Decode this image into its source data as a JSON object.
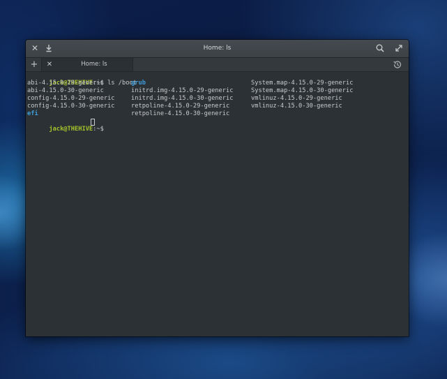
{
  "window": {
    "title": "Home: ls",
    "close_icon": "close-icon",
    "download_icon": "download-icon",
    "search_icon": "search-icon",
    "maximize_icon": "maximize-icon"
  },
  "tabs": {
    "add_icon": "plus-icon",
    "items": [
      {
        "label": "Home: ls",
        "close_icon": "close-icon"
      }
    ],
    "history_icon": "history-icon"
  },
  "terminal": {
    "prompt_user": "jack@THEHIVE",
    "prompt_path": ":~$ ",
    "command": "ls /boot",
    "listing": {
      "col1": [
        {
          "text": "abi-4.15.0-29-generic",
          "type": "file"
        },
        {
          "text": "abi-4.15.0-30-generic",
          "type": "file"
        },
        {
          "text": "config-4.15.0-29-generic",
          "type": "file"
        },
        {
          "text": "config-4.15.0-30-generic",
          "type": "file"
        },
        {
          "text": "efi",
          "type": "dir"
        }
      ],
      "col2": [
        {
          "text": "grub",
          "type": "dir"
        },
        {
          "text": "initrd.img-4.15.0-29-generic",
          "type": "file"
        },
        {
          "text": "initrd.img-4.15.0-30-generic",
          "type": "file"
        },
        {
          "text": "retpoline-4.15.0-29-generic",
          "type": "file"
        },
        {
          "text": "retpoline-4.15.0-30-generic",
          "type": "file"
        }
      ],
      "col3": [
        {
          "text": "System.map-4.15.0-29-generic",
          "type": "file"
        },
        {
          "text": "System.map-4.15.0-30-generic",
          "type": "file"
        },
        {
          "text": "vmlinuz-4.15.0-29-generic",
          "type": "file"
        },
        {
          "text": "vmlinuz-4.15.0-30-generic",
          "type": "file"
        }
      ]
    },
    "second_prompt_user": "jack@THEHIVE",
    "second_prompt_path": ":~$ "
  },
  "colors": {
    "prompt_user": "#a6c22b",
    "directory": "#3e9ddb",
    "text": "#c9ccce",
    "background": "#2c3135"
  }
}
